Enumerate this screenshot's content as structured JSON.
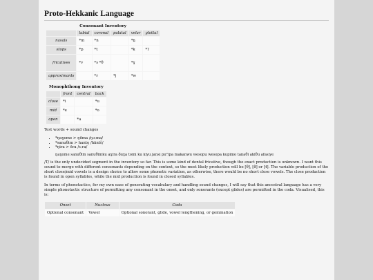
{
  "title": "Proto-Hekkanic Language",
  "consonants": {
    "caption": "Consonant Inventory",
    "headers": [
      "labial",
      "coronal",
      "palatal",
      "velar",
      "glottal"
    ],
    "rows": [
      {
        "label": "nasals",
        "cells": [
          "*m",
          "*n",
          "",
          "*ŋ",
          ""
        ]
      },
      {
        "label": "stops",
        "cells": [
          "*p",
          "*t",
          "",
          "*k",
          "*ʔ"
        ]
      },
      {
        "label": "fricatives",
        "cells": [
          "*v",
          "*s *θ",
          "",
          "*ɣ",
          ""
        ]
      },
      {
        "label": "approximants",
        "cells": [
          "",
          "*r",
          "*j",
          "*w",
          ""
        ]
      }
    ]
  },
  "vowels": {
    "caption": "Monophthong Inventory",
    "headers": [
      "front",
      "central",
      "back"
    ],
    "rows": [
      {
        "label": "close",
        "cells": [
          "*i",
          "",
          "*u"
        ]
      },
      {
        "label": "mid",
        "cells": [
          "*e",
          "",
          "*o"
        ]
      },
      {
        "label": "open",
        "cells": [
          "",
          "*a",
          ""
        ]
      }
    ]
  },
  "test_heading": "Test words + sound changes",
  "test_items": [
    "*ŋaɣome > ŋōma /ŋɔːma/",
    "*sanuθim > hantę /hāntɛ̃/",
    "*ŋira > ēra /ɛːra/"
  ],
  "test_example": "ŋaɣome sanuθim sanuθimku aɣira ðuɣa tomi ku kiyu jansi pu²/pa makanwu wesopu wesopa kupimo tanaθi akiθu afasiye",
  "para1": "/T/ is the only undecided segment in the inventory so far. This is some kind of dental fricative, though the exact production is unknown. I want this sound to merge with different consonants depending on the context, so the most likely production will be [θ], [ð] or [ɬ]. The variable production of the short close/mid vowels is a design choice to allow some phonetic variation, as otherwise, there would be no short close vowels. The close production is found in open syllables, while the mid production is found in closed syllables.",
  "para2": "In terms of phonotactics, for my own ease of generating vocabulary and handling sound changes, I will say that this ancestral language has a very simple phonotactic structure of permitting any consonant in the onset, and only sonorants (except glides) are permitted in the coda. Visualised, this is:",
  "phonotactics": {
    "headers": [
      "Onset",
      "Nucleus",
      "Coda"
    ],
    "cells": [
      "Optional consonant",
      "Vowel",
      "Optional sonorant, glide, vowel lengthening, or gemination"
    ]
  }
}
